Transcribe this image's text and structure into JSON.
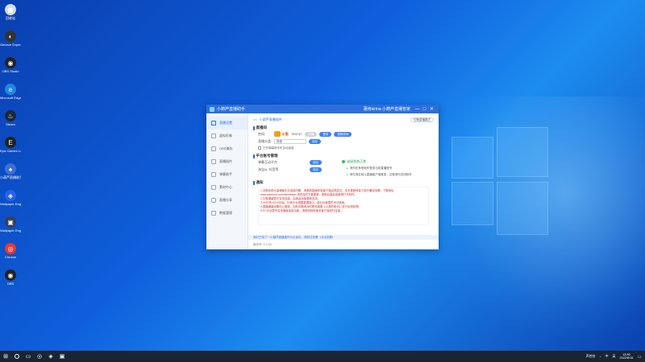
{
  "desktop": {
    "icons": [
      {
        "label": "回收站",
        "color": "#d0dcef",
        "glyph": "▦"
      },
      {
        "label": "Geforce Experience",
        "color": "#333333",
        "glyph": "◐"
      },
      {
        "label": "OBS Studio",
        "color": "#222222",
        "glyph": "◉"
      },
      {
        "label": "Microsoft Edge",
        "color": "#1e88e5",
        "glyph": "e"
      },
      {
        "label": "Steam",
        "color": "#1b2838",
        "glyph": "♨"
      },
      {
        "label": "Epic Games Launcher",
        "color": "#222222",
        "glyph": "E"
      },
      {
        "label": "小葫芦直播助手",
        "color": "#3b6fd8",
        "glyph": "♠"
      },
      {
        "label": "Wallpaper Engine",
        "color": "#2563eb",
        "glyph": "◈"
      },
      {
        "label": "Wallpaper Engine 2",
        "color": "#334155",
        "glyph": "▣"
      },
      {
        "label": "Chrome",
        "color": "#e53935",
        "glyph": "◎"
      },
      {
        "label": "OBS",
        "color": "#222222",
        "glyph": "◉"
      }
    ]
  },
  "window": {
    "title": "小葫芦直播助手",
    "user": "蒲肯kirina  小葫芦直播管家",
    "controls": [
      "—",
      "□",
      "✕"
    ],
    "sidebar": [
      {
        "label": "直播设置",
        "active": true
      },
      {
        "label": "虚拟形象",
        "active": false
      },
      {
        "label": "OBS美化",
        "active": false
      },
      {
        "label": "直播插件",
        "active": false
      },
      {
        "label": "弹幕助手",
        "active": false
      },
      {
        "label": "素材中心",
        "active": false
      },
      {
        "label": "直播分享",
        "active": false
      },
      {
        "label": "数据管理",
        "active": false
      }
    ],
    "topbar": {
      "back": "<<",
      "breadcrumb": "小葫芦直播插件",
      "pill": "切换直播模式"
    },
    "section_room": {
      "title": "直播间",
      "platform_label": "房间:",
      "platform_logo": "斗鱼",
      "room_id": "763747",
      "btn_change": "切换",
      "btn_bind": "登录",
      "btn_account": "更换房间",
      "category_label": "直播分类:",
      "category_value": "其他",
      "btn_save": "保存",
      "checkbox_label": "打开弹幕助手时自动连接"
    },
    "section_platform": {
      "title": "平台账号管理",
      "row1_label": "弹幕互动平台",
      "row1_btn": "绑定",
      "row2_label": "淘宝id, 抖音等",
      "row2_btn": "绑定",
      "status": "连接状态正常",
      "bullets": [
        "请勿在其他软件登录当前直播账号",
        "请在绑定前以直播客户端登录，过程请勿关闭软件"
      ]
    },
    "section_notice": {
      "title": "通知",
      "lines": [
        "1.近期出现大量弹幕无法连接问题，请更新直播伴侣客户端后再尝试，本次更新修复了部分兼容问题，下载地址",
        "www.xiaohulu.com/live/helper  请您及时下载更新，更新后重启电脑再打开软件。",
        "2.抖音弹幕暂不支持连接，后续会持续更新支持。",
        "3.2022年1月10日起，抖音平台调整数据接口，部分功能暂时无法使用。",
        "4.直播弹幕设置中心更新，如有问题请及时联系客服【小葫芦助手】进行反馈处理。",
        "5.PC平台暂不支持弹幕连接功能，请使用其他版本客户端进行连接。"
      ]
    },
    "tipbar": "我们已将了一小葫芦直播插件为云优化，请前往查看（点击查看）",
    "version": "版本号: V 2.33"
  },
  "taskbar": {
    "start_glyph": "⊞",
    "apps": [
      "▭",
      "◎",
      "◈",
      "▣"
    ],
    "tray": [
      "^",
      "中",
      "英",
      "☐"
    ],
    "tray_label": "声控台",
    "time": "13:50",
    "date": "2022/8/16"
  }
}
